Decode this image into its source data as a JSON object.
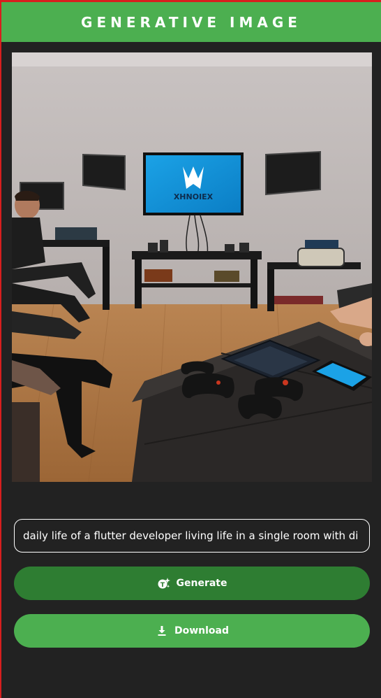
{
  "appbar": {
    "title": "GENERATIVE IMAGE"
  },
  "image": {
    "description_icon": "generated-image",
    "tv_logo_text": "XHNOIEX"
  },
  "prompt": {
    "value": "daily life of a flutter developer living life in a single room with di"
  },
  "buttons": {
    "generate_label": "Generate",
    "generate_icon": "sparkle-icon",
    "download_label": "Download",
    "download_icon": "download-icon"
  },
  "colors": {
    "accent": "#4caf50",
    "accent_dark": "#2e7d32",
    "background": "#222222",
    "border_red": "#d81e1e"
  }
}
